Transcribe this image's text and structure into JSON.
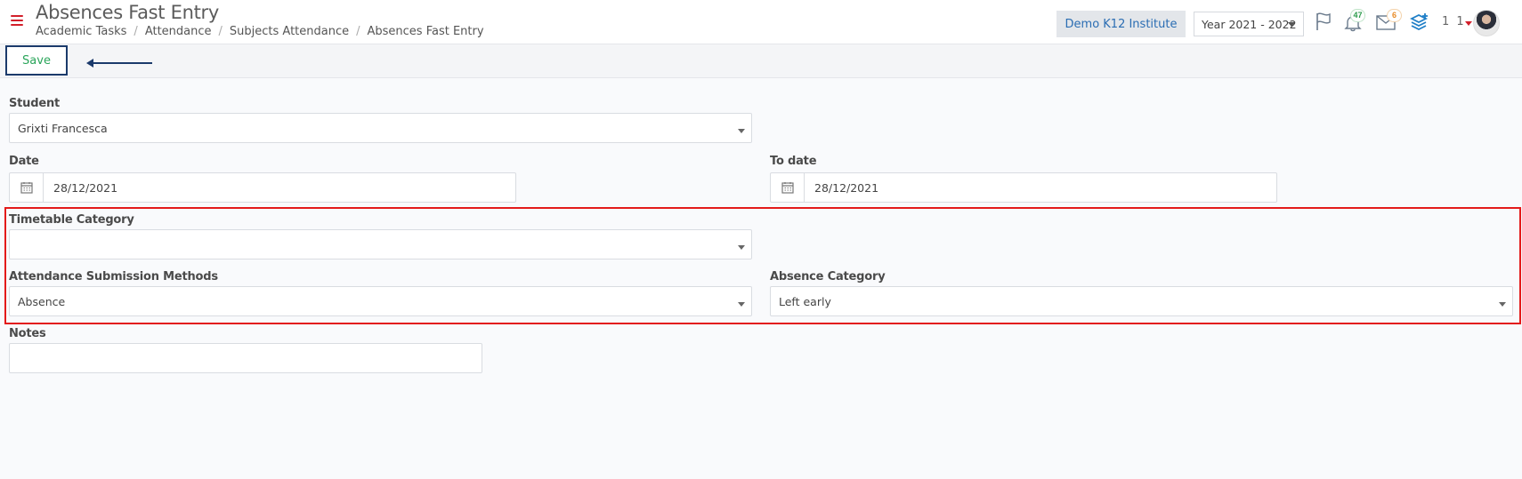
{
  "header": {
    "title": "Absences Fast Entry",
    "breadcrumbs": [
      "Academic Tasks",
      "Attendance",
      "Subjects Attendance",
      "Absences Fast Entry"
    ],
    "institute": "Demo K12 Institute",
    "year": "Year 2021 - 2022",
    "notifications_count": "47",
    "messages_count": "6",
    "user_numbers": "1 1"
  },
  "toolbar": {
    "save_label": "Save"
  },
  "form": {
    "student": {
      "label": "Student",
      "value": "Grixti Francesca"
    },
    "date": {
      "label": "Date",
      "value": "28/12/2021"
    },
    "to_date": {
      "label": "To date",
      "value": "28/12/2021"
    },
    "timetable_category": {
      "label": "Timetable Category",
      "value": ""
    },
    "submission_methods": {
      "label": "Attendance Submission Methods",
      "value": "Absence"
    },
    "absence_category": {
      "label": "Absence Category",
      "value": "Left early"
    },
    "notes": {
      "label": "Notes",
      "value": ""
    }
  },
  "colors": {
    "accent_red": "#d21f2a",
    "save_text": "#2aa55a",
    "save_border": "#1b3a6b",
    "highlight": "#e31a1a",
    "institute_text": "#2a6db3"
  },
  "icons": {
    "menu": "hamburger-icon",
    "flag": "flag-icon",
    "bell": "bell-icon",
    "mail": "envelope-icon",
    "layers": "layers-plus-icon",
    "calendar": "calendar-icon",
    "arrow": "arrow-left-icon"
  }
}
